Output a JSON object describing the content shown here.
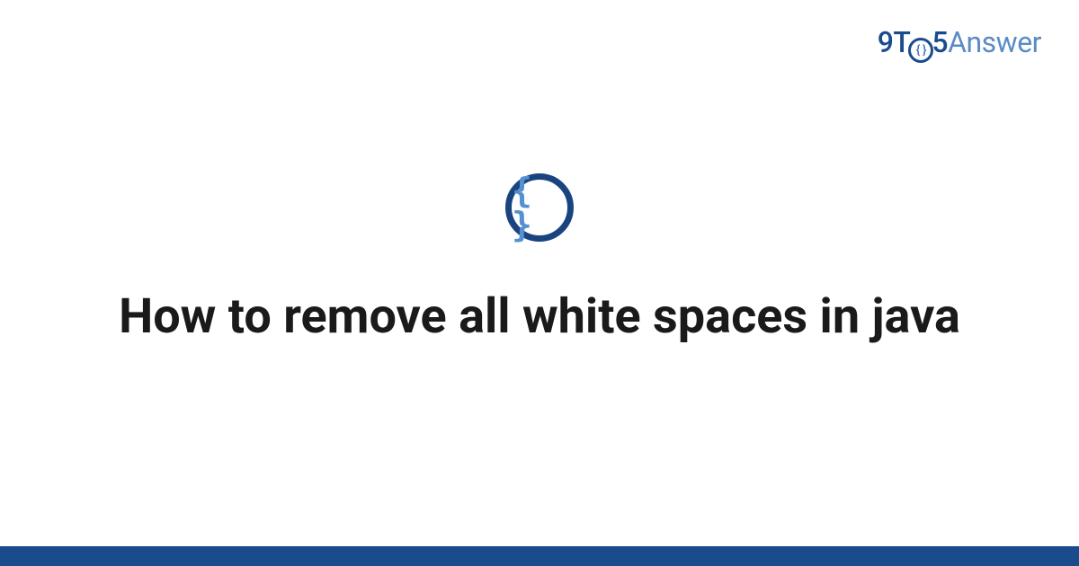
{
  "brand": {
    "part_9t": "9T",
    "part_o_inner": "{ }",
    "part_5": "5",
    "part_answer": "Answer"
  },
  "icon": {
    "name": "code-braces-icon",
    "glyph": "{ }"
  },
  "title": "How to remove all white spaces in java",
  "colors": {
    "brand_dark": "#1a4b8c",
    "brand_light": "#5a8bc8",
    "icon_ring": "#1a4480",
    "icon_braces": "#5590d0",
    "text": "#1a1a1a"
  }
}
